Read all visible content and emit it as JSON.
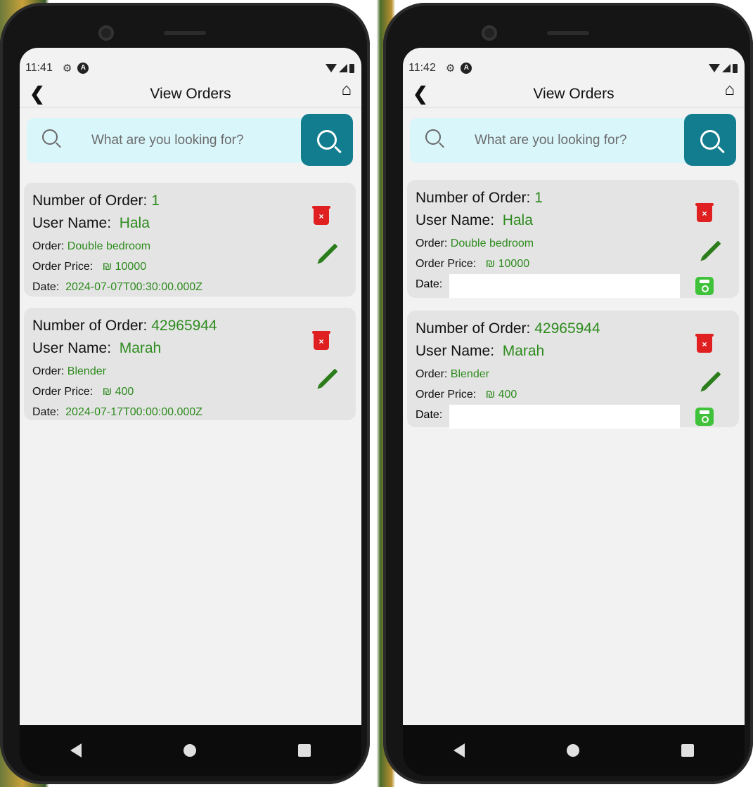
{
  "screens": [
    {
      "status_time": "11:41",
      "title": "View Orders",
      "search_placeholder": "What are you looking for?",
      "orders": [
        {
          "number_label": "Number of Order:",
          "number": "1",
          "user_label": "User Name:",
          "user": "Hala",
          "order_label": "Order:",
          "order": "Double bedroom",
          "price_label": "Order Price:",
          "price": "₪ 10000",
          "date_label": "Date:",
          "date": "2024-07-07T00:30:00.000Z"
        },
        {
          "number_label": "Number of Order:",
          "number": "42965944",
          "user_label": "User Name:",
          "user": "Marah",
          "order_label": "Order:",
          "order": "Blender",
          "price_label": "Order Price:",
          "price": "₪ 400",
          "date_label": "Date:",
          "date": "2024-07-17T00:00:00.000Z"
        }
      ]
    },
    {
      "status_time": "11:42",
      "title": "View Orders",
      "search_placeholder": "What are you looking for?",
      "orders": [
        {
          "number_label": "Number of Order:",
          "number": "1",
          "user_label": "User Name:",
          "user": "Hala",
          "order_label": "Order:",
          "order": "Double bedroom",
          "price_label": "Order Price:",
          "price": "₪ 10000",
          "date_label": "Date:",
          "date_value": ""
        },
        {
          "number_label": "Number of Order:",
          "number": "42965944",
          "user_label": "User Name:",
          "user": "Marah",
          "order_label": "Order:",
          "order": "Blender",
          "price_label": "Order Price:",
          "price": "₪ 400",
          "date_label": "Date:",
          "date_value": ""
        }
      ]
    }
  ],
  "colors": {
    "accent": "#127d8f",
    "value_green": "#2e8b1e",
    "delete_red": "#e02020",
    "save_green": "#3fc23a",
    "search_bg": "#d9f6fb"
  },
  "icons": [
    "back-arrow-icon",
    "home-icon",
    "search-icon",
    "trash-icon",
    "pencil-icon",
    "save-icon",
    "settings-icon",
    "wifi-icon",
    "signal-icon",
    "battery-icon"
  ]
}
